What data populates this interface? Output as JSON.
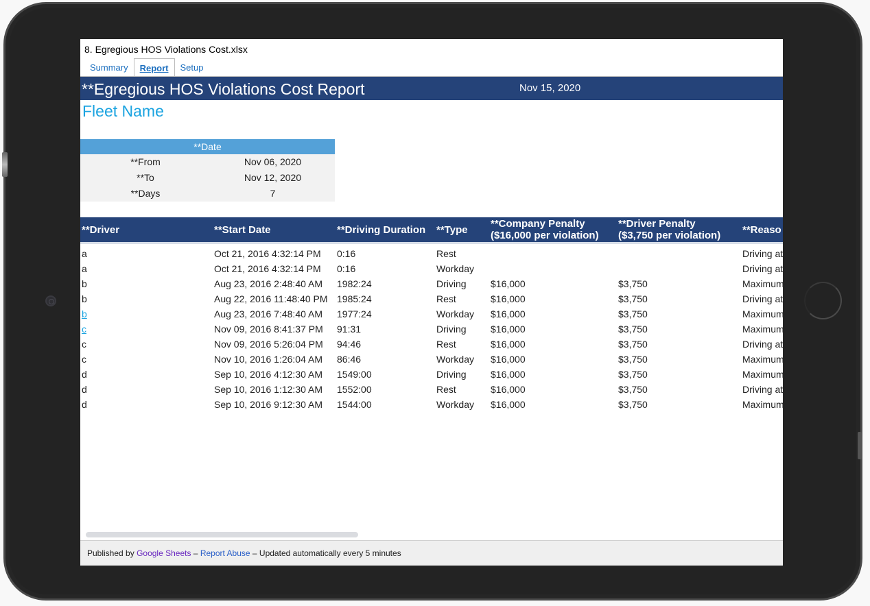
{
  "document": {
    "title": "8. Egregious HOS Violations Cost.xlsx",
    "tabs": [
      {
        "label": "Summary",
        "active": false
      },
      {
        "label": "Report",
        "active": true
      },
      {
        "label": "Setup",
        "active": false
      }
    ]
  },
  "report": {
    "title": "**Egregious HOS Violations Cost Report",
    "generated_date": "Nov 15, 2020",
    "fleet_name": "Fleet Name"
  },
  "date_range": {
    "header": "**Date",
    "rows": [
      {
        "label": "**From",
        "value": "Nov 06, 2020"
      },
      {
        "label": "**To",
        "value": "Nov 12, 2020"
      },
      {
        "label": "**Days",
        "value": "7"
      }
    ]
  },
  "table": {
    "columns": [
      "**Driver",
      "**Start Date",
      "**Driving Duration",
      "**Type",
      "**Company Penalty\n($16,000 per violation)",
      "**Driver Penalty\n($3,750 per violation)",
      "**Reaso"
    ],
    "column_lines": [
      [
        "**Driver"
      ],
      [
        "**Start Date"
      ],
      [
        "**Driving Duration"
      ],
      [
        "**Type"
      ],
      [
        "**Company Penalty",
        "($16,000 per violation)"
      ],
      [
        "**Driver Penalty",
        "($3,750 per violation)"
      ],
      [
        "**Reaso"
      ]
    ],
    "rows": [
      {
        "driver": "a",
        "driver_link": false,
        "start": "Oct 21, 2016 4:32:14 PM",
        "duration": "0:16",
        "type": "Rest",
        "company_penalty": "",
        "driver_penalty": "",
        "reason": "Driving at"
      },
      {
        "driver": "a",
        "driver_link": false,
        "start": "Oct 21, 2016 4:32:14 PM",
        "duration": "0:16",
        "type": "Workday",
        "company_penalty": "",
        "driver_penalty": "",
        "reason": "Driving at"
      },
      {
        "driver": "b",
        "driver_link": false,
        "start": "Aug 23, 2016 2:48:40 AM",
        "duration": "1982:24",
        "type": "Driving",
        "company_penalty": "$16,000",
        "driver_penalty": "$3,750",
        "reason": "Maximum"
      },
      {
        "driver": "b",
        "driver_link": false,
        "start": "Aug 22, 2016 11:48:40 PM",
        "duration": "1985:24",
        "type": "Rest",
        "company_penalty": "$16,000",
        "driver_penalty": "$3,750",
        "reason": "Driving at"
      },
      {
        "driver": "b",
        "driver_link": true,
        "start": "Aug 23, 2016 7:48:40 AM",
        "duration": "1977:24",
        "type": "Workday",
        "company_penalty": "$16,000",
        "driver_penalty": "$3,750",
        "reason": "Maximum"
      },
      {
        "driver": "c",
        "driver_link": true,
        "start": "Nov 09, 2016 8:41:37 PM",
        "duration": "91:31",
        "type": "Driving",
        "company_penalty": "$16,000",
        "driver_penalty": "$3,750",
        "reason": "Maximum"
      },
      {
        "driver": "c",
        "driver_link": false,
        "start": "Nov 09, 2016 5:26:04 PM",
        "duration": "94:46",
        "type": "Rest",
        "company_penalty": "$16,000",
        "driver_penalty": "$3,750",
        "reason": "Driving at"
      },
      {
        "driver": "c",
        "driver_link": false,
        "start": "Nov 10, 2016 1:26:04 AM",
        "duration": "86:46",
        "type": "Workday",
        "company_penalty": "$16,000",
        "driver_penalty": "$3,750",
        "reason": "Maximum"
      },
      {
        "driver": "d",
        "driver_link": false,
        "start": "Sep 10, 2016 4:12:30 AM",
        "duration": "1549:00",
        "type": "Driving",
        "company_penalty": "$16,000",
        "driver_penalty": "$3,750",
        "reason": "Maximum"
      },
      {
        "driver": "d",
        "driver_link": false,
        "start": "Sep 10, 2016 1:12:30 AM",
        "duration": "1552:00",
        "type": "Rest",
        "company_penalty": "$16,000",
        "driver_penalty": "$3,750",
        "reason": "Driving at"
      },
      {
        "driver": "d",
        "driver_link": false,
        "start": "Sep 10, 2016 9:12:30 AM",
        "duration": "1544:00",
        "type": "Workday",
        "company_penalty": "$16,000",
        "driver_penalty": "$3,750",
        "reason": "Maximum"
      }
    ]
  },
  "footer": {
    "published_by": "Published by",
    "google_sheets": "Google Sheets",
    "sep1": "–",
    "report_abuse": "Report Abuse",
    "sep2": "–",
    "updated": "Updated automatically every 5 minutes"
  },
  "colors": {
    "banner": "#254379",
    "date_header": "#54a1d8",
    "fleet_name": "#1aa3e0",
    "tab_link": "#1c6fbf"
  },
  "icons": {
    "camera": "camera-icon",
    "home_button": "home-button-icon"
  }
}
